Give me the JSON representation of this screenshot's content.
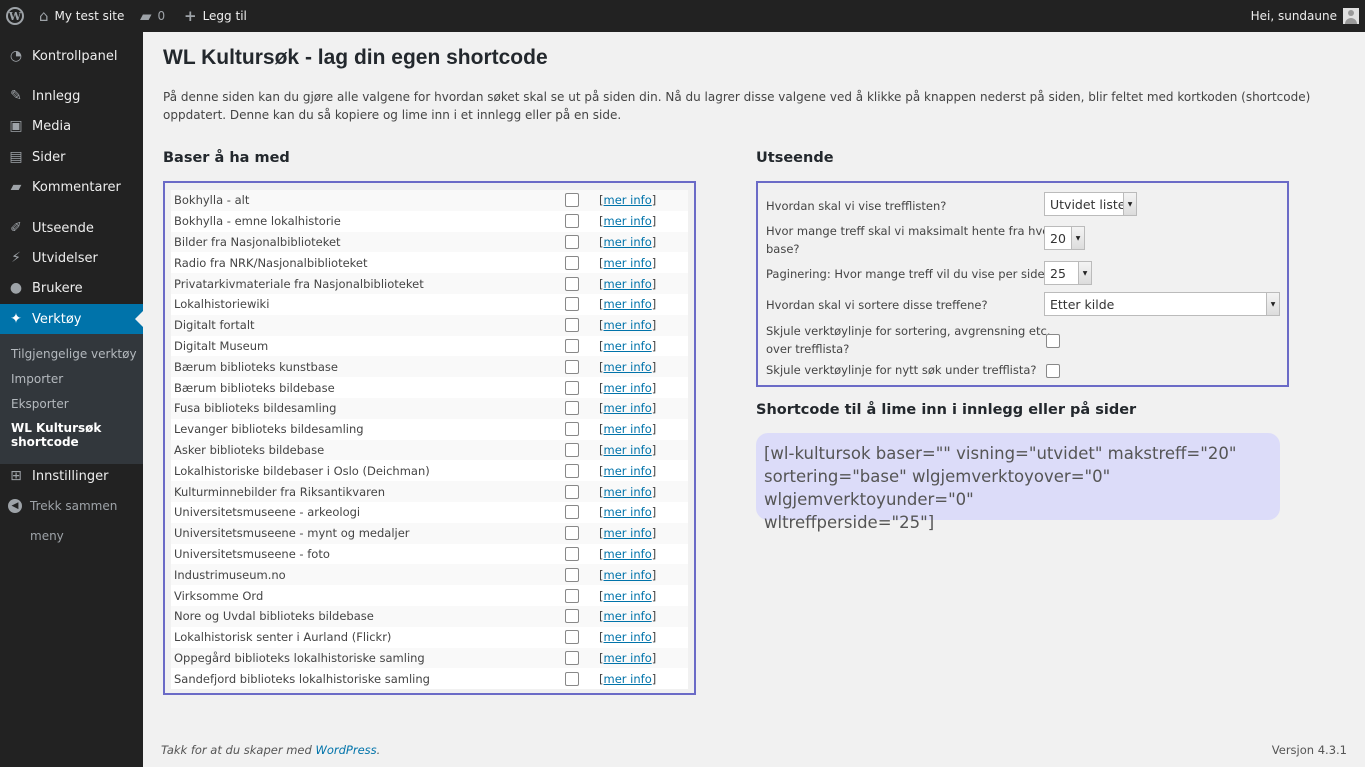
{
  "adminbar": {
    "site_name": "My test site",
    "comments_count": "0",
    "new_label": "Legg til",
    "greeting": "Hei, sundaune"
  },
  "sidebar": {
    "items": [
      {
        "label": "Kontrollpanel",
        "icon": "dashboard-icon"
      },
      {
        "label": "Innlegg",
        "icon": "pin-icon"
      },
      {
        "label": "Media",
        "icon": "media-icon"
      },
      {
        "label": "Sider",
        "icon": "pages-icon"
      },
      {
        "label": "Kommentarer",
        "icon": "comments-icon"
      },
      {
        "label": "Utseende",
        "icon": "appearance-icon"
      },
      {
        "label": "Utvidelser",
        "icon": "plugins-icon"
      },
      {
        "label": "Brukere",
        "icon": "users-icon"
      },
      {
        "label": "Verktøy",
        "icon": "tools-icon"
      },
      {
        "label": "Innstillinger",
        "icon": "settings-icon"
      }
    ],
    "submenu": [
      "Tilgjengelige verktøy",
      "Importer",
      "Eksporter"
    ],
    "submenu_active_line1": "WL Kultursøk",
    "submenu_active_line2": "shortcode",
    "collapse_line1": "Trekk sammen",
    "collapse_line2": "meny"
  },
  "page": {
    "title": "WL Kultursøk - lag din egen shortcode",
    "intro": "På denne siden kan du gjøre alle valgene for hvordan søket skal se ut på siden din. Nå du lagrer disse valgene ved å klikke på knappen nederst på siden, blir feltet med kortkoden (shortcode) oppdatert. Denne kan du så kopiere og lime inn i et innlegg eller på en side."
  },
  "bases": {
    "heading": "Baser å ha med",
    "info_open": "[",
    "info_link": "mer info",
    "info_close": "]",
    "items": [
      "Bokhylla - alt",
      "Bokhylla - emne lokalhistorie",
      "Bilder fra Nasjonalbiblioteket",
      "Radio fra NRK/Nasjonalbiblioteket",
      "Privatarkivmateriale fra Nasjonalbiblioteket",
      "Lokalhistoriewiki",
      "Digitalt fortalt",
      "Digitalt Museum",
      "Bærum biblioteks kunstbase",
      "Bærum biblioteks bildebase",
      "Fusa biblioteks bildesamling",
      "Levanger biblioteks bildesamling",
      "Asker biblioteks bildebase",
      "Lokalhistoriske bildebaser i Oslo (Deichman)",
      "Kulturminnebilder fra Riksantikvaren",
      "Universitetsmuseene - arkeologi",
      "Universitetsmuseene - mynt og medaljer",
      "Universitetsmuseene - foto",
      "Industrimuseum.no",
      "Virksomme Ord",
      "Nore og Uvdal biblioteks bildebase",
      "Lokalhistorisk senter i Aurland (Flickr)",
      "Oppegård biblioteks lokalhistoriske samling",
      "Sandefjord biblioteks lokalhistoriske samling"
    ]
  },
  "appearance": {
    "heading": "Utseende",
    "display_label": "Hvordan skal vi vise trefflisten?",
    "display_value": "Utvidet liste",
    "max_label_line1": "Hvor mange treff skal vi maksimalt hente fra hver",
    "max_label_line2": "base?",
    "max_value": "20",
    "per_page_label": "Paginering: Hvor mange treff vil du vise per side?",
    "per_page_value": "25",
    "sort_label": "Hvordan skal vi sortere disse treffene?",
    "sort_value": "Etter kilde",
    "hide_toolbar_line1": "Skjule verktøylinje for sortering, avgrensning etc.",
    "hide_toolbar_line2": "over trefflista?",
    "hide_search_label": "Skjule verktøylinje for nytt søk under trefflista?"
  },
  "shortcode": {
    "heading": "Shortcode til å lime inn i innlegg eller på sider",
    "line1": "[wl-kultursok baser=\"\" visning=\"utvidet\" makstreff=\"20\"",
    "line2": "sortering=\"base\" wlgjemverktoyover=\"0\" wlgjemverktoyunder=\"0\"",
    "line3": "wltreffperside=\"25\"]"
  },
  "footer": {
    "thanks_prefix": "Takk for at du skaper med",
    "thanks_link": "WordPress",
    "thanks_suffix": ".",
    "version": "Versjon 4.3.1"
  }
}
